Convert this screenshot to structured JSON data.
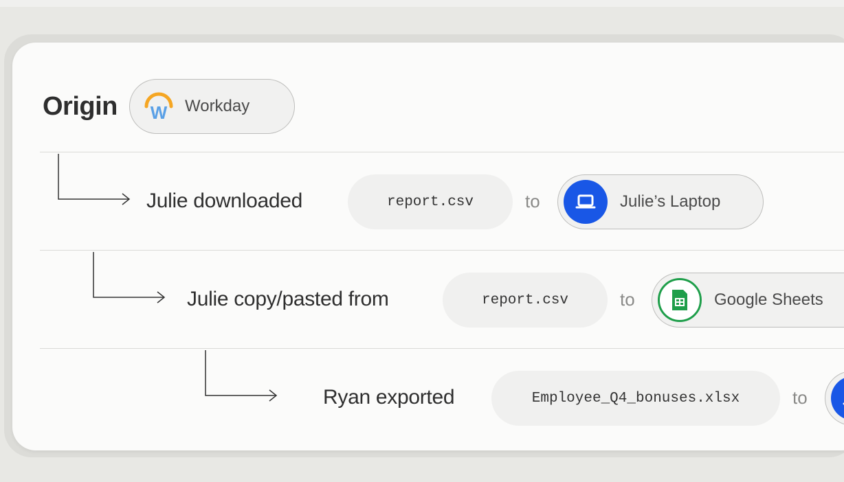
{
  "origin": {
    "title": "Origin",
    "app": {
      "label": "Workday",
      "icon": "workday-logo-icon",
      "colors": {
        "arc": "#f5a623",
        "letter": "#5aa0e6"
      }
    }
  },
  "steps": [
    {
      "action": "Julie downloaded",
      "file": "report.csv",
      "connector": "to",
      "destination": {
        "label": "Julie’s Laptop",
        "icon": "laptop-icon",
        "color": "#1957e6"
      }
    },
    {
      "action": "Julie copy/pasted from",
      "file": "report.csv",
      "connector": "to",
      "destination": {
        "label": "Google Sheets",
        "icon": "google-sheets-icon",
        "color": "#1e9e4a"
      }
    },
    {
      "action": "Ryan exported",
      "file": "Employee_Q4_bonuses.xlsx",
      "connector": "to",
      "destination": {
        "label": "",
        "icon": "laptop-icon",
        "color": "#1957e6"
      }
    }
  ]
}
